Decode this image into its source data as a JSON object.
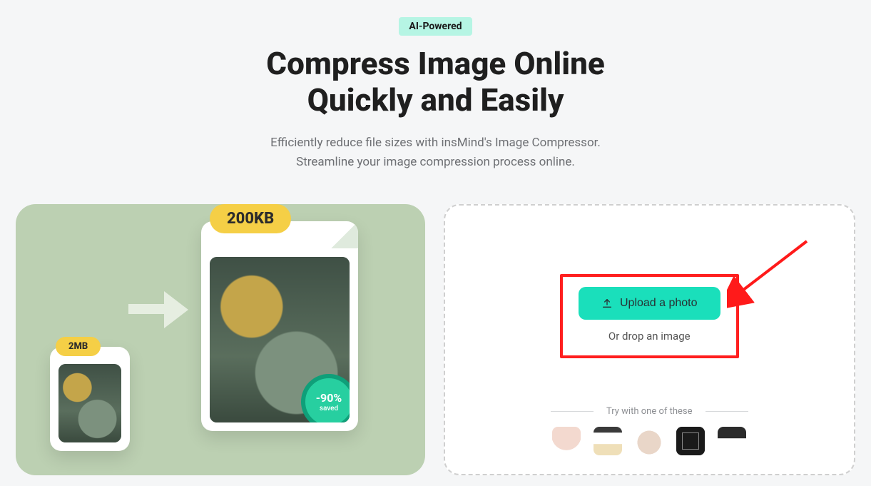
{
  "hero": {
    "badge": "AI-Powered",
    "title_line1": "Compress Image Online",
    "title_line2": "Quickly and Easily",
    "subtitle_line1": "Efficiently reduce file sizes with insMind's Image Compressor.",
    "subtitle_line2": "Streamline your image compression process online."
  },
  "visual": {
    "size_before": "2MB",
    "size_after": "200KB",
    "saved_percent": "-90%",
    "saved_label": "saved"
  },
  "upload": {
    "button_label": "Upload a photo",
    "drop_label": "Or drop an image",
    "try_label": "Try with one of these"
  }
}
